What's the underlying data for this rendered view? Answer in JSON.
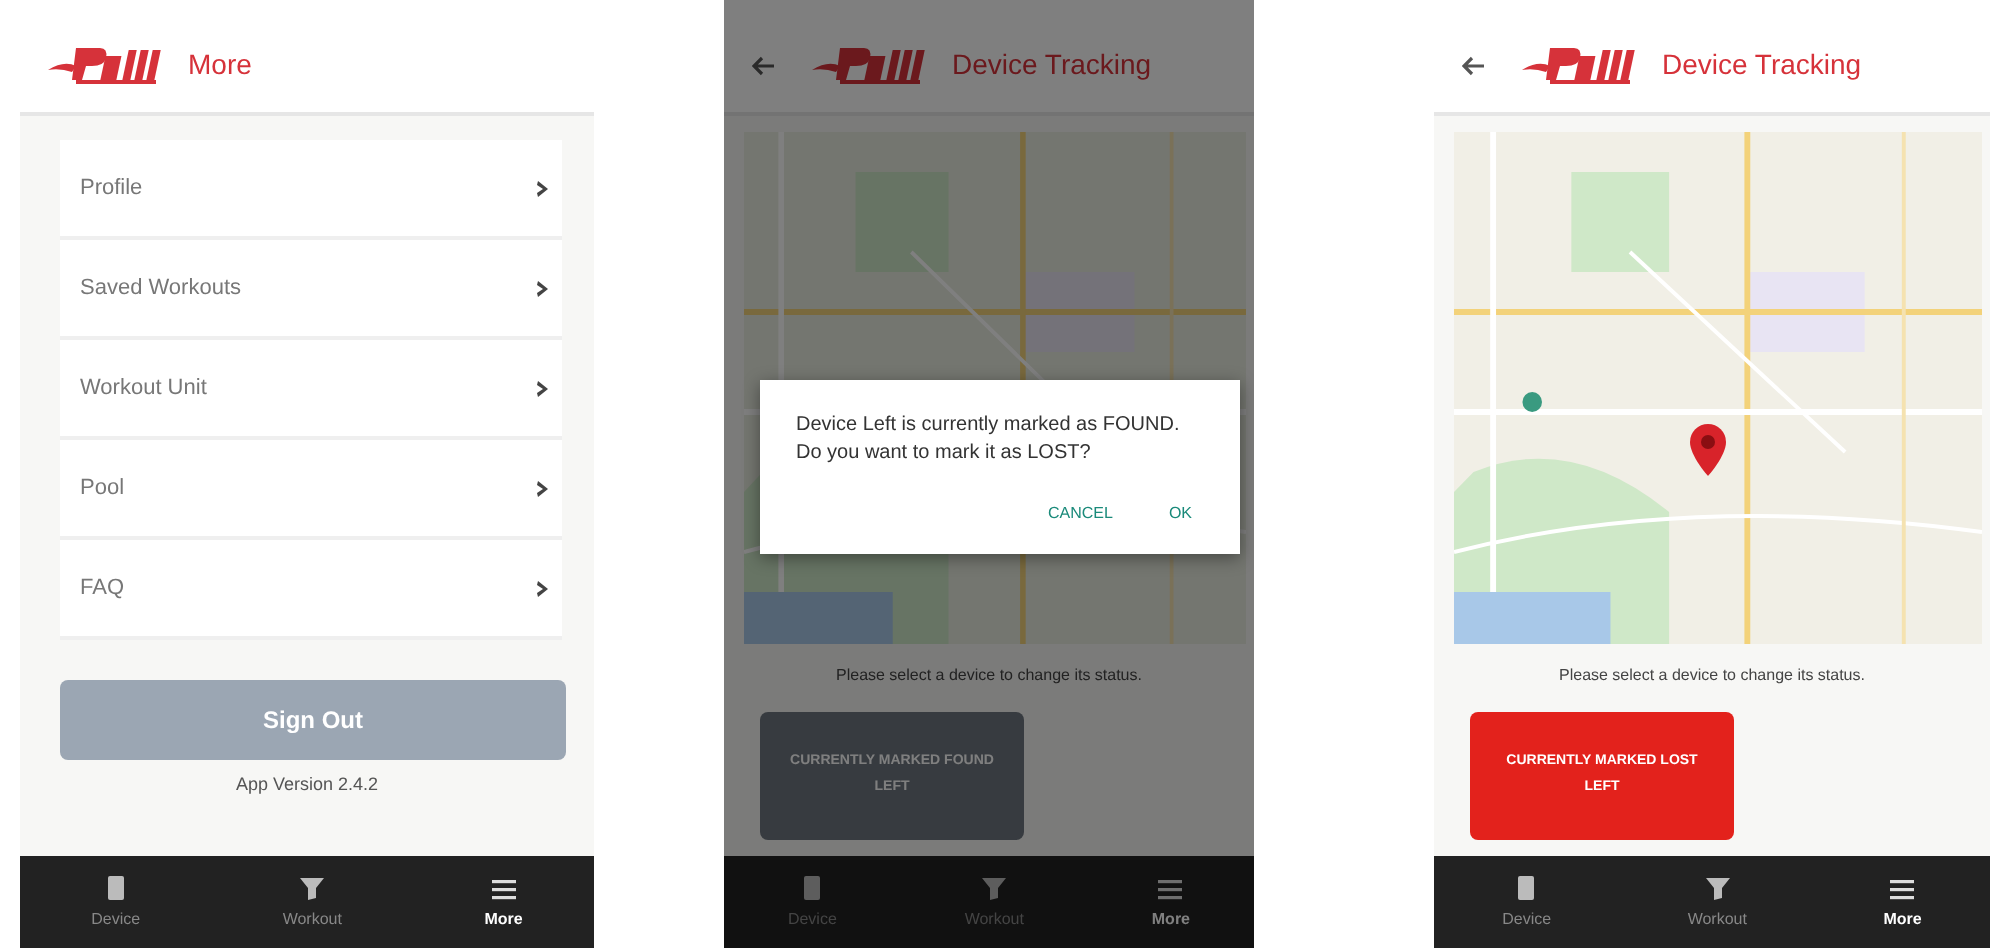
{
  "screens": [
    {
      "kind": "menu",
      "header": {
        "title": "More",
        "back": false
      },
      "menu_items": [
        "Profile",
        "Saved Workouts",
        "Workout Unit",
        "Pool",
        "FAQ"
      ],
      "sign_out": "Sign Out",
      "version": "App Version 2.4.2",
      "nav": [
        {
          "label": "Device",
          "selected": false
        },
        {
          "label": "Workout",
          "selected": false
        },
        {
          "label": "More",
          "selected": true
        }
      ]
    },
    {
      "kind": "tracking",
      "header": {
        "title": "Device Tracking",
        "back": true
      },
      "hint": "Please select a device to change its status.",
      "status_button": {
        "lines": [
          "CURRENTLY MARKED FOUND",
          "LEFT"
        ],
        "lost": false
      },
      "dialog": {
        "message": "Device Left is currently marked as FOUND. Do you want to mark it as LOST?",
        "buttons": [
          "CANCEL",
          "OK"
        ]
      },
      "nav": [
        {
          "label": "Device",
          "selected": false
        },
        {
          "label": "Workout",
          "selected": false
        },
        {
          "label": "More",
          "selected": true
        }
      ]
    },
    {
      "kind": "tracking",
      "header": {
        "title": "Device Tracking",
        "back": true
      },
      "hint": "Please select a device to change its status.",
      "map_marker": true,
      "status_button": {
        "lines": [
          "CURRENTLY MARKED LOST",
          "LEFT"
        ],
        "lost": true
      },
      "nav": [
        {
          "label": "Device",
          "selected": false
        },
        {
          "label": "Workout",
          "selected": false
        },
        {
          "label": "More",
          "selected": true
        }
      ]
    }
  ]
}
